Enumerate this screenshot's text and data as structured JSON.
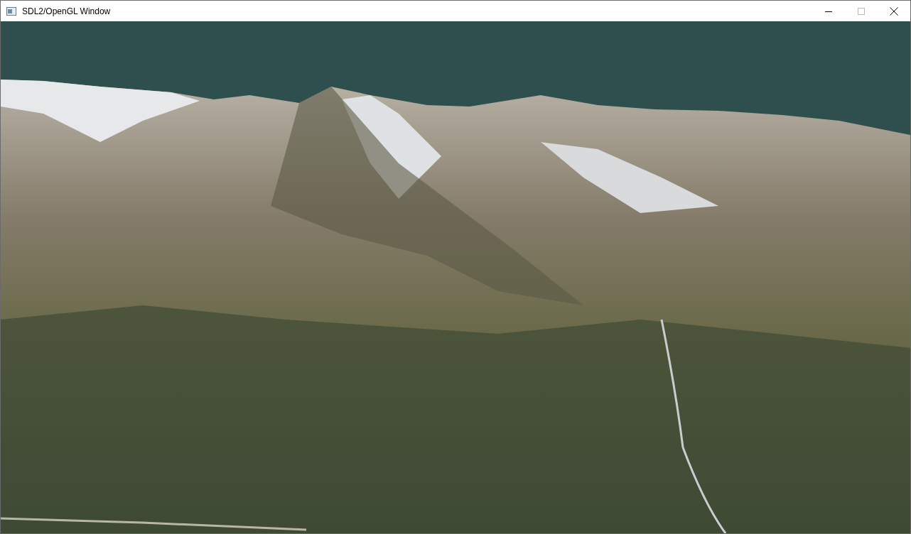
{
  "window": {
    "title": "SDL2/OpenGL Window"
  }
}
